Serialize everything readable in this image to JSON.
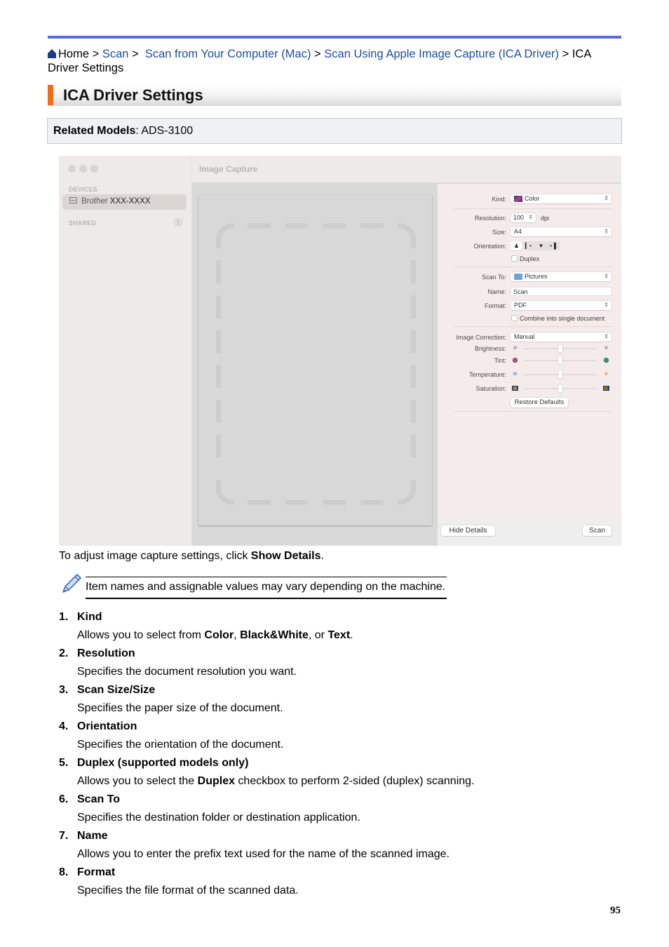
{
  "breadcrumb": {
    "home": "Home",
    "sep": ">",
    "items": [
      {
        "label": "Scan",
        "link": true
      },
      {
        "label": "Scan from Your Computer (Mac)",
        "link": true
      },
      {
        "label": "Scan Using Apple Image Capture (ICA Driver)",
        "link": true
      }
    ],
    "current": "ICA Driver Settings",
    "current_line1": "ICA",
    "current_line2": "Driver Settings"
  },
  "page_title": "ICA Driver Settings",
  "related_models": {
    "label": "Related Models",
    "value": ": ADS-3100"
  },
  "window": {
    "app_title": "Image Capture",
    "sidebar": {
      "devices_header": "DEVICES",
      "device_name_a": "Brother",
      "device_name_b": "XXX-XXXX",
      "shared_header": "SHARED",
      "shared_count": "1"
    },
    "details": {
      "kind": {
        "label": "Kind:",
        "value": "Color"
      },
      "resolution": {
        "label": "Resolution:",
        "value": "100",
        "unit": "dpi"
      },
      "size": {
        "label": "Size:",
        "value": "A4"
      },
      "orientation": {
        "label": "Orientation:",
        "selected_index": 0
      },
      "duplex": {
        "label": "Duplex",
        "checked": false
      },
      "scan_to": {
        "label": "Scan To:",
        "value": "Pictures"
      },
      "name": {
        "label": "Name:",
        "value": "Scan"
      },
      "format": {
        "label": "Format:",
        "value": "PDF"
      },
      "combine": {
        "label": "Combine into single document",
        "checked": false
      },
      "image_correction": {
        "label": "Image Correction:",
        "value": "Manual"
      },
      "brightness": {
        "label": "Brightness:",
        "value_fraction": 0.5
      },
      "tint": {
        "label": "Tint:",
        "value_fraction": 0.5,
        "left_color": "#c0528a",
        "right_color": "#3f9b72"
      },
      "temperature": {
        "label": "Temperature:",
        "value_fraction": 0.5,
        "left_color": "#4a7fd0",
        "right_color": "#e08a50"
      },
      "saturation": {
        "label": "Saturation:",
        "value_fraction": 0.5
      },
      "restore_defaults": "Restore Defaults",
      "hide_details": "Hide Details",
      "scan": "Scan"
    }
  },
  "caption": {
    "prefix": "To adjust image capture settings, click ",
    "bold": "Show Details",
    "suffix": "."
  },
  "note": "Item names and assignable values may vary depending on the machine.",
  "items": [
    {
      "num": "1.",
      "term": "Kind",
      "desc_parts": [
        {
          "t": "Allows you to select from ",
          "b": false
        },
        {
          "t": "Color",
          "b": true
        },
        {
          "t": ", ",
          "b": false
        },
        {
          "t": "Black&White",
          "b": true
        },
        {
          "t": ", or ",
          "b": false
        },
        {
          "t": "Text",
          "b": true
        },
        {
          "t": ".",
          "b": false
        }
      ]
    },
    {
      "num": "2.",
      "term": "Resolution",
      "desc_parts": [
        {
          "t": "Specifies the document resolution you want.",
          "b": false
        }
      ]
    },
    {
      "num": "3.",
      "term": "Scan Size/Size",
      "desc_parts": [
        {
          "t": "Specifies the paper size of the document.",
          "b": false
        }
      ]
    },
    {
      "num": "4.",
      "term": "Orientation",
      "desc_parts": [
        {
          "t": "Specifies the orientation of the document.",
          "b": false
        }
      ]
    },
    {
      "num": "5.",
      "term": "Duplex (supported models only)",
      "desc_parts": [
        {
          "t": "Allows you to select the ",
          "b": false
        },
        {
          "t": "Duplex",
          "b": true
        },
        {
          "t": " checkbox to perform 2-sided (duplex) scanning.",
          "b": false
        }
      ]
    },
    {
      "num": "6.",
      "term": "Scan To",
      "desc_parts": [
        {
          "t": "Specifies the destination folder or destination application.",
          "b": false
        }
      ]
    },
    {
      "num": "7.",
      "term": "Name",
      "desc_parts": [
        {
          "t": "Allows you to enter the prefix text used for the name of the scanned image.",
          "b": false
        }
      ]
    },
    {
      "num": "8.",
      "term": "Format",
      "desc_parts": [
        {
          "t": "Specifies the file format of the scanned data.",
          "b": false
        }
      ]
    }
  ],
  "page_number": "95",
  "colors": {
    "top_rule": "#5a6bd6",
    "link": "#1d4fa0",
    "title_accent": "#f26b17"
  }
}
